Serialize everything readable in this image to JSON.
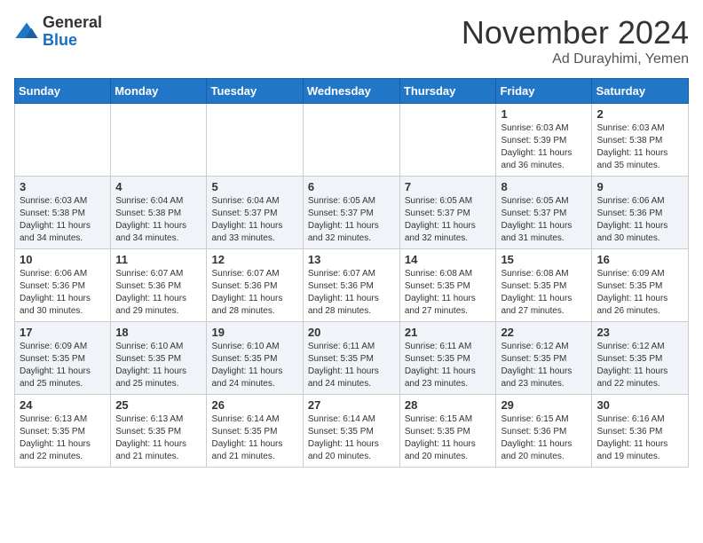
{
  "logo": {
    "general": "General",
    "blue": "Blue"
  },
  "header": {
    "month": "November 2024",
    "location": "Ad Durayhimi, Yemen"
  },
  "weekdays": [
    "Sunday",
    "Monday",
    "Tuesday",
    "Wednesday",
    "Thursday",
    "Friday",
    "Saturday"
  ],
  "weeks": [
    [
      {
        "day": "",
        "info": ""
      },
      {
        "day": "",
        "info": ""
      },
      {
        "day": "",
        "info": ""
      },
      {
        "day": "",
        "info": ""
      },
      {
        "day": "",
        "info": ""
      },
      {
        "day": "1",
        "info": "Sunrise: 6:03 AM\nSunset: 5:39 PM\nDaylight: 11 hours and 36 minutes."
      },
      {
        "day": "2",
        "info": "Sunrise: 6:03 AM\nSunset: 5:38 PM\nDaylight: 11 hours and 35 minutes."
      }
    ],
    [
      {
        "day": "3",
        "info": "Sunrise: 6:03 AM\nSunset: 5:38 PM\nDaylight: 11 hours and 34 minutes."
      },
      {
        "day": "4",
        "info": "Sunrise: 6:04 AM\nSunset: 5:38 PM\nDaylight: 11 hours and 34 minutes."
      },
      {
        "day": "5",
        "info": "Sunrise: 6:04 AM\nSunset: 5:37 PM\nDaylight: 11 hours and 33 minutes."
      },
      {
        "day": "6",
        "info": "Sunrise: 6:05 AM\nSunset: 5:37 PM\nDaylight: 11 hours and 32 minutes."
      },
      {
        "day": "7",
        "info": "Sunrise: 6:05 AM\nSunset: 5:37 PM\nDaylight: 11 hours and 32 minutes."
      },
      {
        "day": "8",
        "info": "Sunrise: 6:05 AM\nSunset: 5:37 PM\nDaylight: 11 hours and 31 minutes."
      },
      {
        "day": "9",
        "info": "Sunrise: 6:06 AM\nSunset: 5:36 PM\nDaylight: 11 hours and 30 minutes."
      }
    ],
    [
      {
        "day": "10",
        "info": "Sunrise: 6:06 AM\nSunset: 5:36 PM\nDaylight: 11 hours and 30 minutes."
      },
      {
        "day": "11",
        "info": "Sunrise: 6:07 AM\nSunset: 5:36 PM\nDaylight: 11 hours and 29 minutes."
      },
      {
        "day": "12",
        "info": "Sunrise: 6:07 AM\nSunset: 5:36 PM\nDaylight: 11 hours and 28 minutes."
      },
      {
        "day": "13",
        "info": "Sunrise: 6:07 AM\nSunset: 5:36 PM\nDaylight: 11 hours and 28 minutes."
      },
      {
        "day": "14",
        "info": "Sunrise: 6:08 AM\nSunset: 5:35 PM\nDaylight: 11 hours and 27 minutes."
      },
      {
        "day": "15",
        "info": "Sunrise: 6:08 AM\nSunset: 5:35 PM\nDaylight: 11 hours and 27 minutes."
      },
      {
        "day": "16",
        "info": "Sunrise: 6:09 AM\nSunset: 5:35 PM\nDaylight: 11 hours and 26 minutes."
      }
    ],
    [
      {
        "day": "17",
        "info": "Sunrise: 6:09 AM\nSunset: 5:35 PM\nDaylight: 11 hours and 25 minutes."
      },
      {
        "day": "18",
        "info": "Sunrise: 6:10 AM\nSunset: 5:35 PM\nDaylight: 11 hours and 25 minutes."
      },
      {
        "day": "19",
        "info": "Sunrise: 6:10 AM\nSunset: 5:35 PM\nDaylight: 11 hours and 24 minutes."
      },
      {
        "day": "20",
        "info": "Sunrise: 6:11 AM\nSunset: 5:35 PM\nDaylight: 11 hours and 24 minutes."
      },
      {
        "day": "21",
        "info": "Sunrise: 6:11 AM\nSunset: 5:35 PM\nDaylight: 11 hours and 23 minutes."
      },
      {
        "day": "22",
        "info": "Sunrise: 6:12 AM\nSunset: 5:35 PM\nDaylight: 11 hours and 23 minutes."
      },
      {
        "day": "23",
        "info": "Sunrise: 6:12 AM\nSunset: 5:35 PM\nDaylight: 11 hours and 22 minutes."
      }
    ],
    [
      {
        "day": "24",
        "info": "Sunrise: 6:13 AM\nSunset: 5:35 PM\nDaylight: 11 hours and 22 minutes."
      },
      {
        "day": "25",
        "info": "Sunrise: 6:13 AM\nSunset: 5:35 PM\nDaylight: 11 hours and 21 minutes."
      },
      {
        "day": "26",
        "info": "Sunrise: 6:14 AM\nSunset: 5:35 PM\nDaylight: 11 hours and 21 minutes."
      },
      {
        "day": "27",
        "info": "Sunrise: 6:14 AM\nSunset: 5:35 PM\nDaylight: 11 hours and 20 minutes."
      },
      {
        "day": "28",
        "info": "Sunrise: 6:15 AM\nSunset: 5:35 PM\nDaylight: 11 hours and 20 minutes."
      },
      {
        "day": "29",
        "info": "Sunrise: 6:15 AM\nSunset: 5:36 PM\nDaylight: 11 hours and 20 minutes."
      },
      {
        "day": "30",
        "info": "Sunrise: 6:16 AM\nSunset: 5:36 PM\nDaylight: 11 hours and 19 minutes."
      }
    ]
  ]
}
